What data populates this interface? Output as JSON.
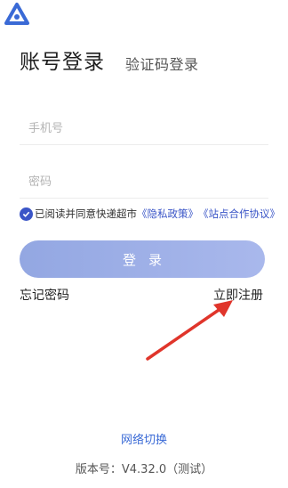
{
  "tabs": {
    "account": "账号登录",
    "sms": "验证码登录"
  },
  "form": {
    "phone_placeholder": "手机号",
    "phone_value": "",
    "password_placeholder": "密码",
    "password_value": ""
  },
  "agreement": {
    "checked": true,
    "prefix": "已阅读并同意快递超市",
    "privacy_link": "《隐私政策》",
    "station_link": "《站点合作协议》"
  },
  "login_button": "登录",
  "forgot_password": "忘记密码",
  "register": "立即注册",
  "network_switch": "网络切换",
  "version": "版本号：V4.32.0（测试）",
  "colors": {
    "accent": "#3a55c7",
    "button": "#9fb0e8",
    "link": "#3a6ad6",
    "arrow": "#e0352b"
  },
  "icons": {
    "logo": "triangle-logo-icon",
    "check": "check-circle-icon",
    "annotation": "red-arrow-icon"
  }
}
